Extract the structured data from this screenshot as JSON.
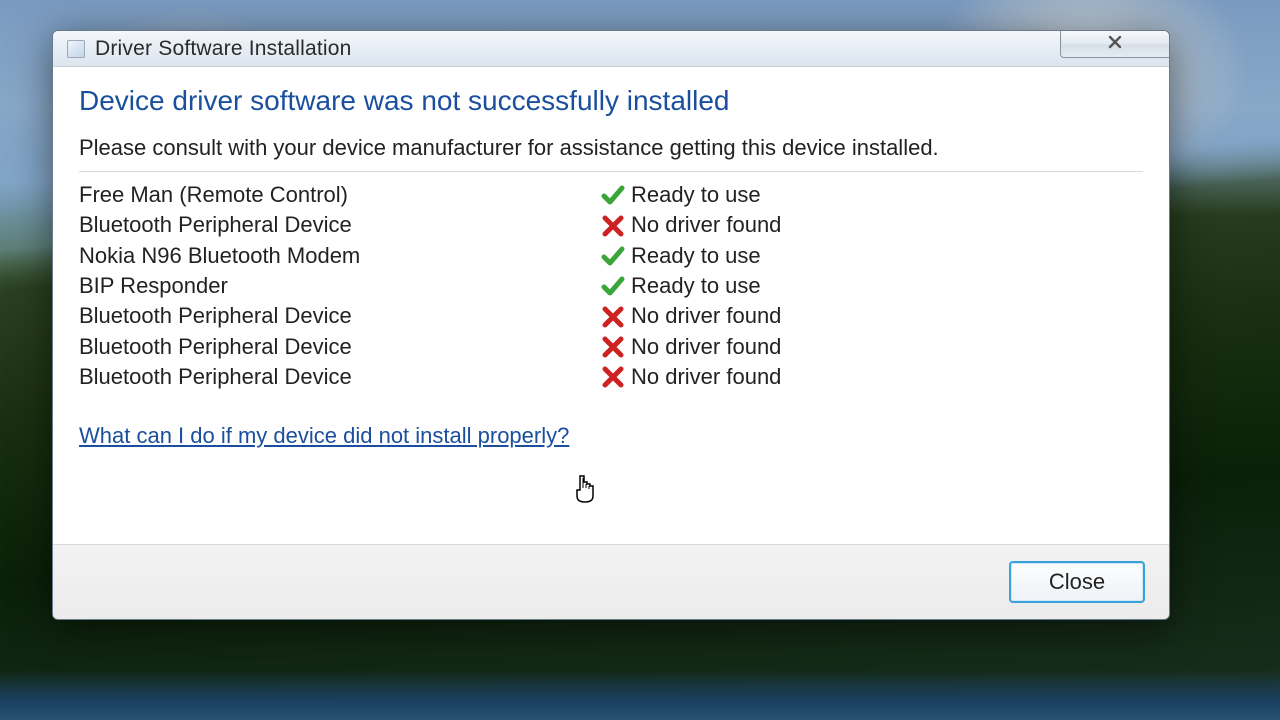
{
  "window": {
    "title": "Driver Software Installation"
  },
  "main": {
    "heading": "Device driver software was not successfully installed",
    "instruction": "Please consult with your device manufacturer for assistance getting this device installed.",
    "help_link": "What can I do if my device did not install properly?"
  },
  "status_labels": {
    "ready": "Ready to use",
    "no_driver": "No driver found"
  },
  "devices": [
    {
      "name": "Free Man (Remote Control)",
      "status": "ready"
    },
    {
      "name": "Bluetooth Peripheral Device",
      "status": "no_driver"
    },
    {
      "name": "Nokia N96 Bluetooth Modem",
      "status": "ready"
    },
    {
      "name": "BIP Responder",
      "status": "ready"
    },
    {
      "name": "Bluetooth Peripheral Device",
      "status": "no_driver"
    },
    {
      "name": "Bluetooth Peripheral Device",
      "status": "no_driver"
    },
    {
      "name": "Bluetooth Peripheral Device",
      "status": "no_driver"
    }
  ],
  "footer": {
    "close_label": "Close"
  },
  "colors": {
    "heading": "#1a4e9e",
    "link": "#1a4e9e",
    "success": "#3aa63a",
    "error": "#c22"
  }
}
